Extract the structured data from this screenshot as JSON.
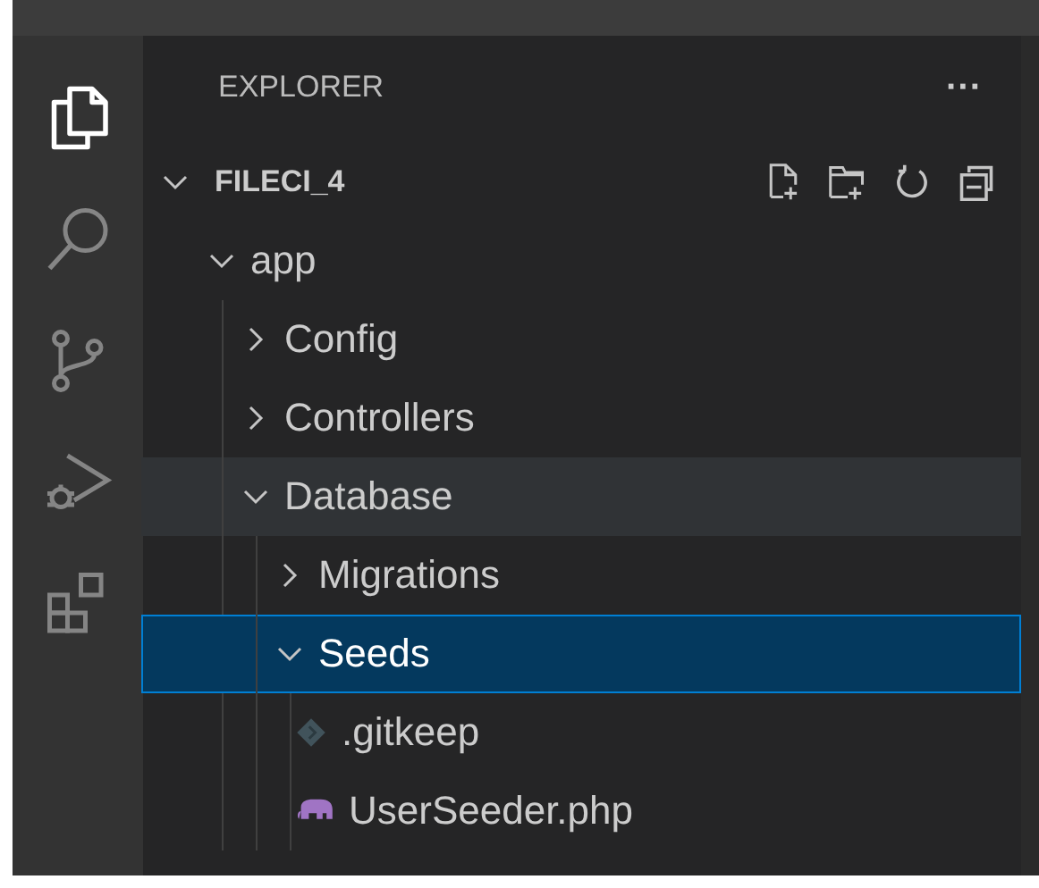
{
  "activity_bar": [
    {
      "kind": "explorer",
      "selected": true
    },
    {
      "kind": "search",
      "selected": false
    },
    {
      "kind": "scm",
      "selected": false
    },
    {
      "kind": "debug",
      "selected": false
    },
    {
      "kind": "extensions",
      "selected": false
    }
  ],
  "sidebar": {
    "title": "EXPLORER",
    "more": "···",
    "root": {
      "label": "FILECI_4",
      "expanded": true
    },
    "tree": [
      {
        "label": "app",
        "kind": "folder",
        "expanded": true,
        "selected": false,
        "hovered": false,
        "children": [
          {
            "label": "Config",
            "kind": "folder",
            "expanded": false,
            "selected": false,
            "hovered": false
          },
          {
            "label": "Controllers",
            "kind": "folder",
            "expanded": false,
            "selected": false,
            "hovered": false
          },
          {
            "label": "Database",
            "kind": "folder",
            "expanded": true,
            "selected": false,
            "hovered": true,
            "children": [
              {
                "label": "Migrations",
                "kind": "folder",
                "expanded": false,
                "selected": false,
                "hovered": false
              },
              {
                "label": "Seeds",
                "kind": "folder",
                "expanded": true,
                "selected": true,
                "hovered": false,
                "children": [
                  {
                    "label": ".gitkeep",
                    "kind": "gitkeep",
                    "selected": false,
                    "hovered": false
                  },
                  {
                    "label": "UserSeeder.php",
                    "kind": "php",
                    "selected": false,
                    "hovered": false
                  }
                ]
              }
            ]
          }
        ]
      }
    ]
  }
}
